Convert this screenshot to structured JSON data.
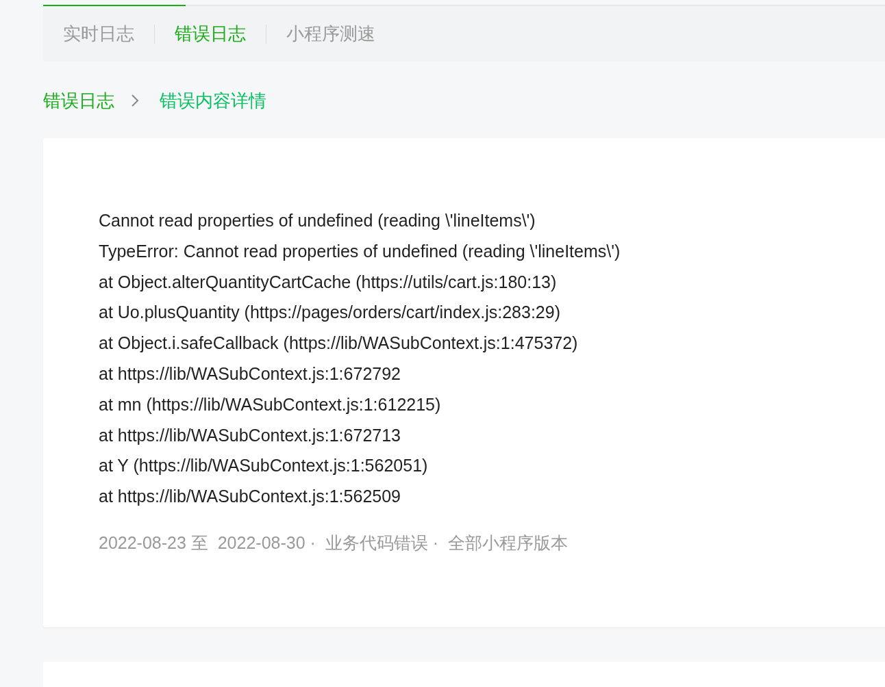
{
  "tabs": [
    {
      "label": "实时日志",
      "selected": false
    },
    {
      "label": "错误日志",
      "selected": true
    },
    {
      "label": "小程序测速",
      "selected": false
    }
  ],
  "breadcrumb": [
    {
      "label": "错误日志",
      "current": false
    },
    {
      "label": "错误内容详情",
      "current": true
    }
  ],
  "error_detail": {
    "lines": [
      "Cannot read properties of undefined (reading \\'lineItems\\')",
      "TypeError: Cannot read properties of undefined (reading \\'lineItems\\')",
      "at Object.alterQuantityCartCache (https://utils/cart.js:180:13)",
      "at Uo.plusQuantity (https://pages/orders/cart/index.js:283:29)",
      "at Object.i.safeCallback (https://lib/WASubContext.js:1:475372)",
      "at https://lib/WASubContext.js:1:672792",
      "at mn (https://lib/WASubContext.js:1:612215)",
      "at https://lib/WASubContext.js:1:672713",
      "at Y (https://lib/WASubContext.js:1:562051)",
      "at https://lib/WASubContext.js:1:562509"
    ],
    "meta": "2022-08-23 至  2022-08-30 ·  业务代码错误 ·  全部小程序版本"
  }
}
